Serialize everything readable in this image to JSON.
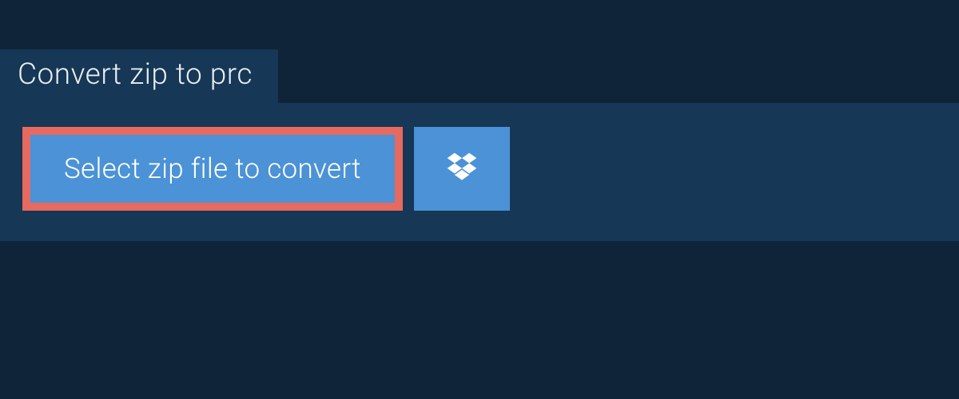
{
  "header": {
    "tab_label": "Convert zip to prc"
  },
  "actions": {
    "select_file_label": "Select zip file to convert"
  }
}
